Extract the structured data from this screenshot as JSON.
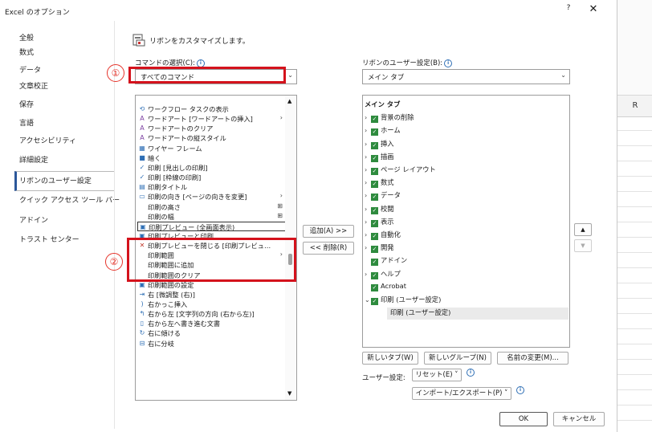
{
  "window": {
    "title": "Excel のオプション",
    "help_glyph": "?",
    "close_glyph": "✕"
  },
  "nav": {
    "items": [
      {
        "label": "全般"
      },
      {
        "label": "数式"
      },
      {
        "label": "データ"
      },
      {
        "label": "文章校正"
      },
      {
        "label": "保存"
      },
      {
        "label": "言語"
      },
      {
        "label": "アクセシビリティ"
      },
      {
        "label": "詳細設定"
      },
      {
        "label": "リボンのユーザー設定"
      },
      {
        "label": "クイック アクセス ツール バー"
      },
      {
        "label": "アドイン"
      },
      {
        "label": "トラスト センター"
      }
    ],
    "selected_index": 8
  },
  "header": {
    "customize_label": "リボンをカスタマイズします。"
  },
  "commands": {
    "choose_label": "コマンドの選択(C):",
    "choose_value": "すべてのコマンド",
    "list": [
      {
        "icon": "⟲",
        "label": "ワークフロー タスクの表示",
        "sub": ""
      },
      {
        "icon": "A",
        "label": "ワードアート [ワードアートの挿入]",
        "sub": "›"
      },
      {
        "icon": "A",
        "label": "ワードアートのクリア",
        "sub": ""
      },
      {
        "icon": "A",
        "label": "ワードアートの縦スタイル",
        "sub": ""
      },
      {
        "icon": "▦",
        "label": "ワイヤー フレーム",
        "sub": ""
      },
      {
        "icon": "■",
        "label": "暗く",
        "sub": ""
      },
      {
        "icon": "✓",
        "label": "印刷 [見出しの印刷]",
        "sub": ""
      },
      {
        "icon": "✓",
        "label": "印刷 [枠線の印刷]",
        "sub": ""
      },
      {
        "icon": "▤",
        "label": "印刷タイトル",
        "sub": ""
      },
      {
        "icon": "▭",
        "label": "印刷の向き [ページの向きを変更]",
        "sub": "›"
      },
      {
        "icon": "",
        "label": "印刷の高さ",
        "sub": "⊞"
      },
      {
        "icon": "",
        "label": "印刷の幅",
        "sub": "⊞"
      },
      {
        "icon": "▣",
        "label": "印刷プレビュー (全画面表示)",
        "sub": ""
      },
      {
        "icon": "▣",
        "label": "印刷プレビューと印刷",
        "sub": ""
      },
      {
        "icon": "✕",
        "label": "印刷プレビューを閉じる [印刷プレビュ…",
        "sub": ""
      },
      {
        "icon": "",
        "label": "印刷範囲",
        "sub": "›"
      },
      {
        "icon": "",
        "label": "印刷範囲に追加",
        "sub": ""
      },
      {
        "icon": "",
        "label": "印刷範囲のクリア",
        "sub": ""
      },
      {
        "icon": "▣",
        "label": "印刷範囲の設定",
        "sub": ""
      },
      {
        "icon": "⇥",
        "label": "右 [微調整 (右)]",
        "sub": ""
      },
      {
        "icon": ")",
        "label": "右かっこ挿入",
        "sub": ""
      },
      {
        "icon": "↰",
        "label": "右から左 [文字列の方向 (右から左)]",
        "sub": ""
      },
      {
        "icon": "▯",
        "label": "右から左へ書き進む文書",
        "sub": ""
      },
      {
        "icon": "↻",
        "label": "右に傾ける",
        "sub": ""
      },
      {
        "icon": "⊟",
        "label": "右に分岐",
        "sub": ""
      }
    ],
    "selected_index": 12,
    "annotation_1": "①",
    "annotation_2": "②"
  },
  "middle": {
    "add_label": "追加(A) >>",
    "remove_label": "<< 削除(R)"
  },
  "ribbon": {
    "label": "リボンのユーザー設定(B):",
    "value": "メイン タブ",
    "tree": [
      {
        "label": "メイン タブ",
        "level": 0,
        "chev": "",
        "check": false,
        "bold": true
      },
      {
        "label": "背景の削除",
        "level": 1,
        "chev": "›",
        "check": true
      },
      {
        "label": "ホーム",
        "level": 1,
        "chev": "›",
        "check": true
      },
      {
        "label": "挿入",
        "level": 1,
        "chev": "›",
        "check": true
      },
      {
        "label": "描画",
        "level": 1,
        "chev": "›",
        "check": true
      },
      {
        "label": "ページ レイアウト",
        "level": 1,
        "chev": "›",
        "check": true
      },
      {
        "label": "数式",
        "level": 1,
        "chev": "›",
        "check": true
      },
      {
        "label": "データ",
        "level": 1,
        "chev": "›",
        "check": true
      },
      {
        "label": "校閲",
        "level": 1,
        "chev": "›",
        "check": true
      },
      {
        "label": "表示",
        "level": 1,
        "chev": "›",
        "check": true
      },
      {
        "label": "自動化",
        "level": 1,
        "chev": "›",
        "check": true
      },
      {
        "label": "開発",
        "level": 1,
        "chev": "›",
        "check": true
      },
      {
        "label": "アドイン",
        "level": 1,
        "chev": "",
        "check": true
      },
      {
        "label": "ヘルプ",
        "level": 1,
        "chev": "›",
        "check": true
      },
      {
        "label": "Acrobat",
        "level": 1,
        "chev": "",
        "check": true
      },
      {
        "label": "印刷 (ユーザー設定)",
        "level": 1,
        "chev": "⌄",
        "check": true
      },
      {
        "label": "印刷 (ユーザー設定)",
        "level": 2,
        "chev": "",
        "check": false
      }
    ],
    "up_glyph": "▲",
    "down_glyph": "▼",
    "new_tab": "新しいタブ(W)",
    "new_group": "新しいグループ(N)",
    "rename": "名前の変更(M)...",
    "user_setting_label": "ユーザー設定:",
    "reset": "リセット(E) ˅",
    "import_export": "インポート/エクスポート(P) ˅"
  },
  "footer": {
    "ok": "OK",
    "cancel": "キャンセル"
  },
  "excel": {
    "column_header": "R"
  },
  "info_glyph": "i",
  "colors": {
    "annotation_red": "#d4121c",
    "check_green": "#2e8b3e",
    "accent": "#2b579a"
  }
}
